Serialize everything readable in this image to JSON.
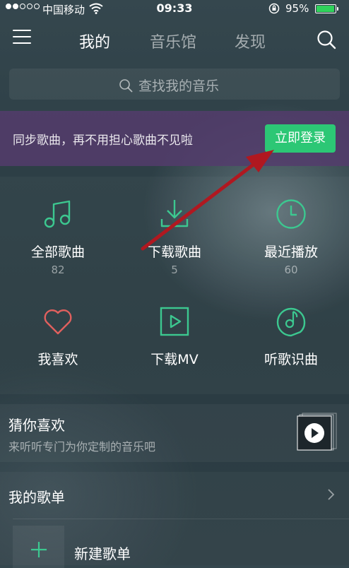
{
  "status_bar": {
    "carrier": "中国移动",
    "time": "09:33",
    "battery": "95%",
    "battery_level": 0.95
  },
  "nav": {
    "tabs": [
      {
        "label": "我的",
        "active": true
      },
      {
        "label": "音乐馆",
        "active": false
      },
      {
        "label": "发现",
        "active": false
      }
    ]
  },
  "search": {
    "placeholder": "查找我的音乐"
  },
  "login_banner": {
    "text": "同步歌曲，再不用担心歌曲不见啦",
    "button": "立即登录"
  },
  "grid": {
    "items": [
      {
        "label": "全部歌曲",
        "count": "82",
        "icon": "music-note-icon"
      },
      {
        "label": "下载歌曲",
        "count": "5",
        "icon": "download-icon"
      },
      {
        "label": "最近播放",
        "count": "60",
        "icon": "clock-icon"
      },
      {
        "label": "我喜欢",
        "icon": "heart-icon"
      },
      {
        "label": "下载MV",
        "icon": "play-box-icon"
      },
      {
        "label": "听歌识曲",
        "icon": "music-recognition-icon"
      }
    ]
  },
  "guess": {
    "title": "猜你喜欢",
    "subtitle": "来听听专门为你定制的音乐吧"
  },
  "playlists": {
    "title": "我的歌单",
    "new_label": "新建歌单"
  },
  "colors": {
    "accent_green": "#2cc775",
    "icon_green": "#3cc890",
    "heart_red": "#e0605e",
    "banner_purple": "#543c6c",
    "annotation_red": "#b01820"
  }
}
